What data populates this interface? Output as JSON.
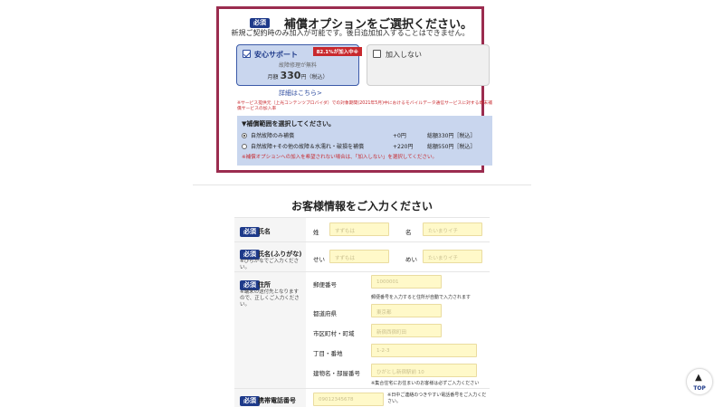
{
  "option": {
    "required": "必須",
    "title": "補償オプションをご選択ください。",
    "subtitle": "新規ご契約時のみ加入が可能です。後日追加加入することはできません。",
    "card_a": {
      "label": "安心サポート",
      "badge": "82.1%が加入中※",
      "note": "故障修理が無料",
      "price_prefix": "月額",
      "price": "330",
      "price_suffix": "円（税込）",
      "checked": true
    },
    "card_b": {
      "label": "加入しない",
      "checked": false
    },
    "detail_link": "詳細はこちら>",
    "fine_print": "※サービス提供元（上光コンテンツプロバイダ）での対象期間(2021年5月)中におけるモバイルデータ通信サービスに対する端末補償サービスの加入率",
    "range": {
      "title": "▼補償範囲を選択してください。",
      "rows": [
        {
          "label": "自然故障のみ補償",
          "add": "+0円",
          "total": "総額330円［税込］",
          "selected": true
        },
        {
          "label": "自然故障+その他の故障＆水濡れ・破損を補償",
          "add": "+220円",
          "total": "総額550円［税込］",
          "selected": false
        }
      ],
      "warning": "※補償オプションへの加入を希望されない場合は、「加入しない」を選択してください。"
    }
  },
  "customer": {
    "title": "お客様情報をご入力ください",
    "required": "必須",
    "name": {
      "label": "氏名",
      "last_label": "姓",
      "last_placeholder": "すずもは",
      "first_label": "名",
      "first_placeholder": "たいまりイチ"
    },
    "kana": {
      "label": "氏名(ふりがな)",
      "note": "※ひらがなでご入力ください。",
      "last_label": "せい",
      "last_placeholder": "すずもは",
      "first_label": "めい",
      "first_placeholder": "たいまりイチ"
    },
    "address": {
      "label": "住所",
      "note": "※端末の送付先となりますので、正しくご入力ください。",
      "zip_label": "郵便番号",
      "zip_placeholder": "1000001",
      "zip_hint": "郵便番号を入力すると住所が自動で入力されます",
      "pref_label": "都道府県",
      "pref_placeholder": "東京都",
      "city_label": "市区町村・町域",
      "city_placeholder": "新宿西宿町田",
      "block_label": "丁目・番地",
      "block_placeholder": "1-2-3",
      "bldg_label": "建物名・部屋番号",
      "bldg_placeholder": "ひがとし新宿駅前 10",
      "bldg_hint": "※集合住宅にお住まいのお客様は必ずご入力ください"
    },
    "phone": {
      "label": "携帯電話番号",
      "placeholder": "09012345678",
      "hint": "※日中ご連絡のつきやすい電話番号をご入力ください。"
    }
  },
  "top_button": {
    "label": "TOP"
  }
}
